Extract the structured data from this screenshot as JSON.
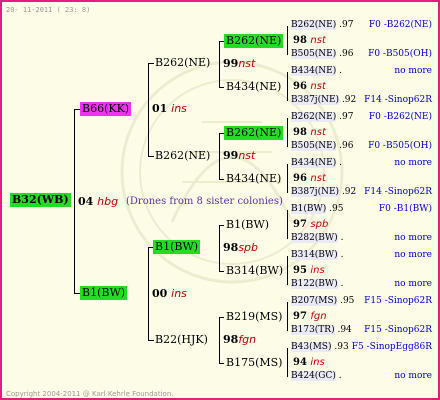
{
  "header": "20- 11-2011 ( 23:  8)",
  "footer": "Copyright 2004-2011 @ Karl Kehrle Foundation.",
  "colors": {
    "border": "#e0207a",
    "green": "#22dd22",
    "magenta": "#ee33ee",
    "link": "#0000cc",
    "year": "#c00000",
    "note": "#5a2fb0"
  },
  "root": {
    "label": "B32(WB)",
    "num": "04",
    "yr": "hbg",
    "note": "(Drones from 8 sister colonies)"
  },
  "gen1": [
    {
      "label": "B66(KK)",
      "num": "01",
      "yr": "ins"
    },
    {
      "label": "B1(BW)",
      "num": "00",
      "yr": "ins"
    }
  ],
  "gen2": [
    {
      "label": "B262(NE)",
      "num": "99",
      "yr": "nst"
    },
    {
      "label": "B262(NE)",
      "num": "99",
      "yr": "nst"
    },
    {
      "label": "B1(BW)",
      "num": "98",
      "yr": "spb"
    },
    {
      "label": "B22(HJK)",
      "num": "98",
      "yr": "fgn"
    }
  ],
  "gen3": [
    {
      "label": "B262(NE)",
      "num": "98",
      "yr": "nst"
    },
    {
      "label": "B434(NE)",
      "num": "96",
      "yr": "nst"
    },
    {
      "label": "B262(NE)",
      "num": "98",
      "yr": "nst"
    },
    {
      "label": "B434(NE)",
      "num": "96",
      "yr": "nst"
    },
    {
      "label": "B1(BW)",
      "num": "97",
      "yr": "spb"
    },
    {
      "label": "B314(BW)",
      "num": "95",
      "yr": "ins"
    },
    {
      "label": "B219(MS)",
      "num": "97",
      "yr": "fgn"
    },
    {
      "label": "B175(MS)",
      "num": "94",
      "yr": "ins"
    }
  ],
  "gen4": [
    {
      "label": "B262(NE)",
      "suffix": ".97",
      "right": "F0 -B262(NE)"
    },
    {
      "label": "B505(NE)",
      "suffix": ".96",
      "right": "F0 -B505(OH)"
    },
    {
      "label": "B434(NE)",
      "suffix": ".",
      "right": "no more"
    },
    {
      "label": "B387j(NE)",
      "suffix": ".92",
      "right": "F14 -Sinop62R"
    },
    {
      "label": "B262(NE)",
      "suffix": ".97",
      "right": "F0 -B262(NE)"
    },
    {
      "label": "B505(NE)",
      "suffix": ".96",
      "right": "F0 -B505(OH)"
    },
    {
      "label": "B434(NE)",
      "suffix": ".",
      "right": "no more"
    },
    {
      "label": "B387j(NE)",
      "suffix": ".92",
      "right": "F14 -Sinop62R"
    },
    {
      "label": "B1(BW)",
      "suffix": ".95",
      "right": "F0 -B1(BW)"
    },
    {
      "label": "B282(BW)",
      "suffix": ".",
      "right": "no more"
    },
    {
      "label": "B314(BW)",
      "suffix": ".",
      "right": "no more"
    },
    {
      "label": "B122(BW)",
      "suffix": ".",
      "right": "no more"
    },
    {
      "label": "B207(MS)",
      "suffix": ".95",
      "right": "F15 -Sinop62R"
    },
    {
      "label": "B173(TR)",
      "suffix": ".94",
      "right": "F15 -Sinop62R"
    },
    {
      "label": "B43(MS)",
      "suffix": ".93",
      "right": "F5 -SinopEgg86R"
    },
    {
      "label": "B424(GC)",
      "suffix": ".",
      "right": "no more"
    }
  ]
}
